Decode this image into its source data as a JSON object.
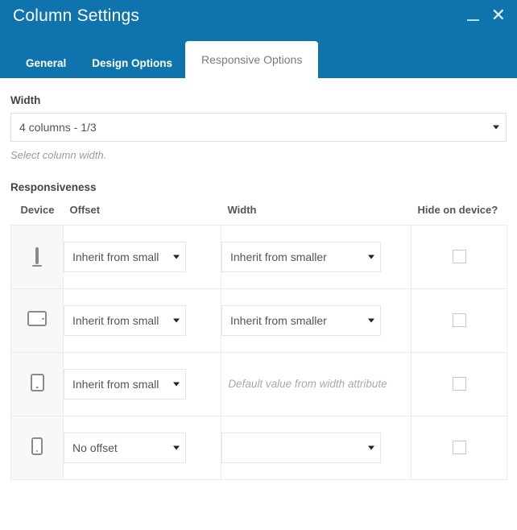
{
  "window": {
    "title": "Column Settings",
    "minimize_icon": "minimize-icon",
    "close_icon": "close-icon",
    "header_color": "#0f74ad"
  },
  "tabs": [
    {
      "label": "General",
      "active": false
    },
    {
      "label": "Design Options",
      "active": false
    },
    {
      "label": "Responsive Options",
      "active": true
    }
  ],
  "width_field": {
    "label": "Width",
    "value": "4 columns - 1/3",
    "hint": "Select column width."
  },
  "responsiveness": {
    "section_title": "Responsiveness",
    "columns": [
      {
        "key": "device",
        "label": "Device"
      },
      {
        "key": "offset",
        "label": "Offset"
      },
      {
        "key": "width",
        "label": "Width"
      },
      {
        "key": "hide",
        "label": "Hide on device?"
      }
    ],
    "rows": [
      {
        "device_icon": "desktop-icon",
        "device_name": "desktop",
        "offset_value": "Inherit from small",
        "width_value": "Inherit from smaller",
        "width_is_placeholder": false,
        "width_empty": false,
        "hide_checked": false
      },
      {
        "device_icon": "tablet-landscape-icon",
        "device_name": "tablet-landscape",
        "offset_value": "Inherit from small",
        "width_value": "Inherit from smaller",
        "width_is_placeholder": false,
        "width_empty": false,
        "hide_checked": false
      },
      {
        "device_icon": "tablet-portrait-icon",
        "device_name": "tablet-portrait",
        "offset_value": "Inherit from small",
        "width_value": "Default value from width attribute",
        "width_is_placeholder": true,
        "width_empty": false,
        "hide_checked": false
      },
      {
        "device_icon": "mobile-icon",
        "device_name": "mobile",
        "offset_value": "No offset",
        "width_value": "",
        "width_is_placeholder": false,
        "width_empty": true,
        "hide_checked": false
      }
    ]
  }
}
